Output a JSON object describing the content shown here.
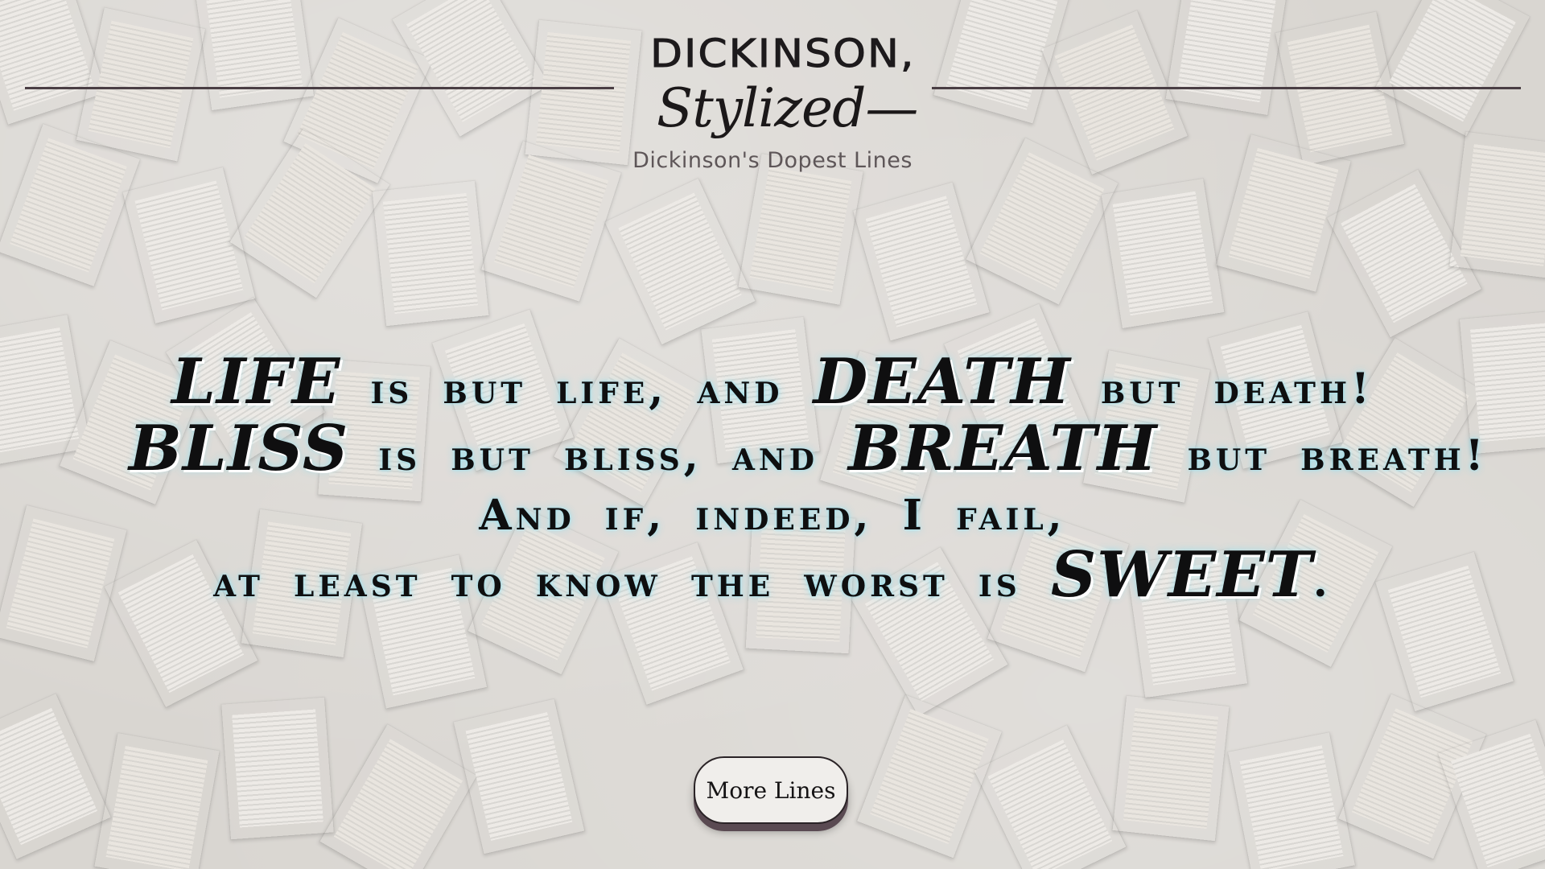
{
  "header": {
    "logo_top": "DICKINSON,",
    "logo_bottom": "Stylized—",
    "tagline": "Dickinson's Dopest Lines"
  },
  "quote": {
    "line1": {
      "w1": "LIFE",
      "t1": "is but life, and",
      "w2": "DEATH",
      "t2": "but death!"
    },
    "line2": {
      "w1": "BLISS",
      "t1": "is but bliss, and",
      "w2": "BREATH",
      "t2": "but breath!"
    },
    "line3": {
      "t1": "And if, indeed, I fail,"
    },
    "line4": {
      "t1": "at least to know the worst is",
      "w1": "SWEET",
      "t2": "."
    }
  },
  "more_button": {
    "label": "More Lines"
  },
  "colors": {
    "text": "#0f0f10",
    "glow": "#96e1f0",
    "rule": "#4a3e44",
    "button_bg": "#f0eeeb",
    "button_shadow": "#5a4a52"
  }
}
